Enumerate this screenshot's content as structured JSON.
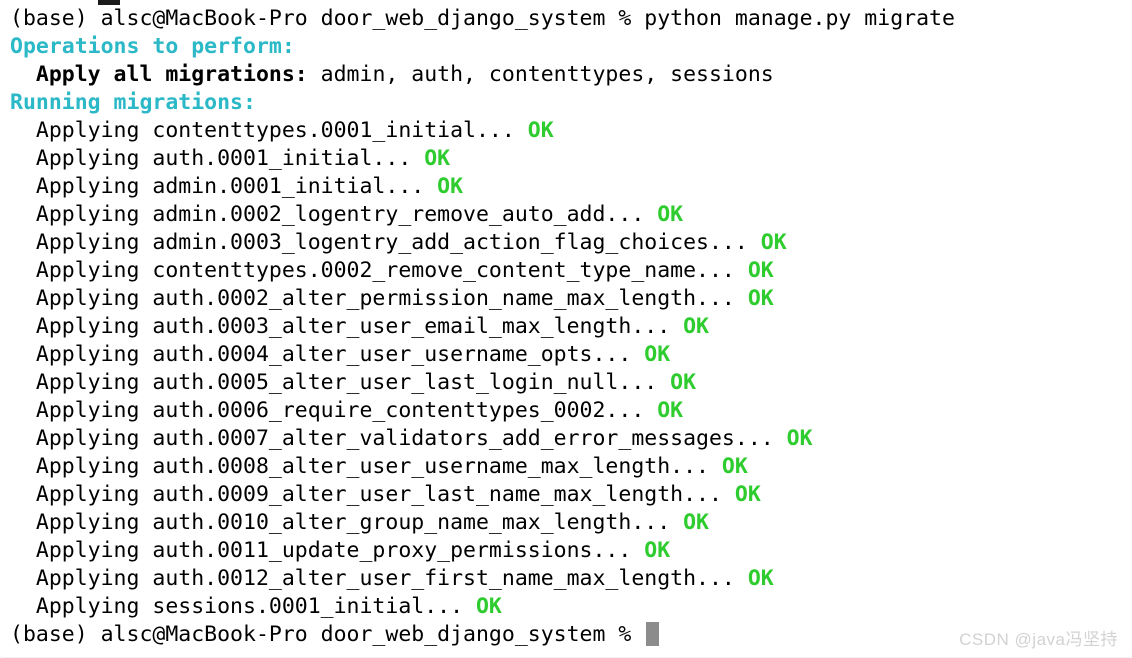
{
  "terminal": {
    "shell_env": "(base)",
    "user_host": "alsc@MacBook-Pro",
    "cwd": "door_web_django_system",
    "prompt_symbol": "%",
    "command": "python manage.py migrate",
    "cursor": "block-cursor",
    "colors": {
      "background": "#ffffff",
      "foreground": "#000000",
      "cyan": "#2bb8c7",
      "green": "#2ecc2e",
      "cursor": "#8c8c8c",
      "watermark": "#d2d2d2"
    }
  },
  "watermark": "CSDN @java冯坚持",
  "lines": [
    {
      "id": "prompt-command",
      "segments": [
        {
          "text": "(base) alsc@MacBook-Pro door_web_django_system % python manage.py migrate",
          "style": "default"
        }
      ]
    },
    {
      "id": "operations-header",
      "segments": [
        {
          "text": "Operations to perform:",
          "style": "cyan"
        }
      ]
    },
    {
      "id": "apply-all-migrations",
      "segments": [
        {
          "text": "  Apply all migrations:",
          "style": "bold"
        },
        {
          "text": " admin, auth, contenttypes, sessions",
          "style": "default"
        }
      ]
    },
    {
      "id": "running-migrations-header",
      "segments": [
        {
          "text": "Running migrations:",
          "style": "cyan"
        }
      ]
    },
    {
      "id": "migration-contenttypes-0001",
      "segments": [
        {
          "text": "  Applying contenttypes.0001_initial...",
          "style": "default"
        },
        {
          "text": " OK",
          "style": "green"
        }
      ]
    },
    {
      "id": "migration-auth-0001",
      "segments": [
        {
          "text": "  Applying auth.0001_initial...",
          "style": "default"
        },
        {
          "text": " OK",
          "style": "green"
        }
      ]
    },
    {
      "id": "migration-admin-0001",
      "segments": [
        {
          "text": "  Applying admin.0001_initial...",
          "style": "default"
        },
        {
          "text": " OK",
          "style": "green"
        }
      ]
    },
    {
      "id": "migration-admin-0002",
      "segments": [
        {
          "text": "  Applying admin.0002_logentry_remove_auto_add...",
          "style": "default"
        },
        {
          "text": " OK",
          "style": "green"
        }
      ]
    },
    {
      "id": "migration-admin-0003",
      "segments": [
        {
          "text": "  Applying admin.0003_logentry_add_action_flag_choices...",
          "style": "default"
        },
        {
          "text": " OK",
          "style": "green"
        }
      ]
    },
    {
      "id": "migration-contenttypes-0002",
      "segments": [
        {
          "text": "  Applying contenttypes.0002_remove_content_type_name...",
          "style": "default"
        },
        {
          "text": " OK",
          "style": "green"
        }
      ]
    },
    {
      "id": "migration-auth-0002",
      "segments": [
        {
          "text": "  Applying auth.0002_alter_permission_name_max_length...",
          "style": "default"
        },
        {
          "text": " OK",
          "style": "green"
        }
      ]
    },
    {
      "id": "migration-auth-0003",
      "segments": [
        {
          "text": "  Applying auth.0003_alter_user_email_max_length...",
          "style": "default"
        },
        {
          "text": " OK",
          "style": "green"
        }
      ]
    },
    {
      "id": "migration-auth-0004",
      "segments": [
        {
          "text": "  Applying auth.0004_alter_user_username_opts...",
          "style": "default"
        },
        {
          "text": " OK",
          "style": "green"
        }
      ]
    },
    {
      "id": "migration-auth-0005",
      "segments": [
        {
          "text": "  Applying auth.0005_alter_user_last_login_null...",
          "style": "default"
        },
        {
          "text": " OK",
          "style": "green"
        }
      ]
    },
    {
      "id": "migration-auth-0006",
      "segments": [
        {
          "text": "  Applying auth.0006_require_contenttypes_0002...",
          "style": "default"
        },
        {
          "text": " OK",
          "style": "green"
        }
      ]
    },
    {
      "id": "migration-auth-0007",
      "segments": [
        {
          "text": "  Applying auth.0007_alter_validators_add_error_messages...",
          "style": "default"
        },
        {
          "text": " OK",
          "style": "green"
        }
      ]
    },
    {
      "id": "migration-auth-0008",
      "segments": [
        {
          "text": "  Applying auth.0008_alter_user_username_max_length...",
          "style": "default"
        },
        {
          "text": " OK",
          "style": "green"
        }
      ]
    },
    {
      "id": "migration-auth-0009",
      "segments": [
        {
          "text": "  Applying auth.0009_alter_user_last_name_max_length...",
          "style": "default"
        },
        {
          "text": " OK",
          "style": "green"
        }
      ]
    },
    {
      "id": "migration-auth-0010",
      "segments": [
        {
          "text": "  Applying auth.0010_alter_group_name_max_length...",
          "style": "default"
        },
        {
          "text": " OK",
          "style": "green"
        }
      ]
    },
    {
      "id": "migration-auth-0011",
      "segments": [
        {
          "text": "  Applying auth.0011_update_proxy_permissions...",
          "style": "default"
        },
        {
          "text": " OK",
          "style": "green"
        }
      ]
    },
    {
      "id": "migration-auth-0012",
      "segments": [
        {
          "text": "  Applying auth.0012_alter_user_first_name_max_length...",
          "style": "default"
        },
        {
          "text": " OK",
          "style": "green"
        }
      ]
    },
    {
      "id": "migration-sessions-0001",
      "segments": [
        {
          "text": "  Applying sessions.0001_initial...",
          "style": "default"
        },
        {
          "text": " OK",
          "style": "green"
        }
      ]
    },
    {
      "id": "prompt-idle",
      "segments": [
        {
          "text": "(base) alsc@MacBook-Pro door_web_django_system % ",
          "style": "default"
        }
      ],
      "cursor": true
    }
  ]
}
